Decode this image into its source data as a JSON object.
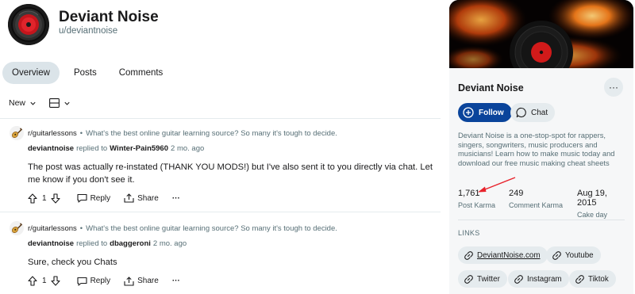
{
  "profile": {
    "name": "Deviant Noise",
    "username": "u/deviantnoise"
  },
  "tabs": [
    {
      "label": "Overview",
      "active": true
    },
    {
      "label": "Posts",
      "active": false
    },
    {
      "label": "Comments",
      "active": false
    }
  ],
  "sort": {
    "label": "New"
  },
  "comments": [
    {
      "subreddit": "r/guitarlessons",
      "separator": "•",
      "post_title": "What's the best online guitar learning source? So many it's tough to decide.",
      "author": "deviantnoise",
      "replied_to_label": "replied to",
      "replied_to": "Winter-Pain5960",
      "age": "2 mo. ago",
      "body": "The post was actually re-instated (THANK YOU MODS!) but I've also sent it to you directly via chat. Let me know if you don't see it.",
      "score": "1",
      "reply_label": "Reply",
      "share_label": "Share",
      "more_label": "···"
    },
    {
      "subreddit": "r/guitarlessons",
      "separator": "•",
      "post_title": "What's the best online guitar learning source? So many it's tough to decide.",
      "author": "deviantnoise",
      "replied_to_label": "replied to",
      "replied_to": "dbaggeroni",
      "age": "2 mo. ago",
      "body": "Sure, check you Chats",
      "score": "1",
      "reply_label": "Reply",
      "share_label": "Share",
      "more_label": "···"
    }
  ],
  "sidebar": {
    "title": "Deviant Noise",
    "more_label": "···",
    "follow_label": "Follow",
    "chat_label": "Chat",
    "about": "Deviant Noise is a one-stop-spot for rappers, singers, songwriters, music producers and musicians! Learn how to make music today and download our free music making cheat sheets",
    "stats": [
      {
        "value": "1,761",
        "label": "Post Karma"
      },
      {
        "value": "249",
        "label": "Comment Karma"
      },
      {
        "value": "Aug 19, 2015",
        "label": "Cake day"
      }
    ],
    "links_heading": "LINKS",
    "links": [
      {
        "label": "DeviantNoise.com"
      },
      {
        "label": "Youtube"
      },
      {
        "label": "Twitter"
      },
      {
        "label": "Instagram"
      },
      {
        "label": "Tiktok"
      }
    ]
  },
  "colors": {
    "accent": "#0a449b",
    "annotation_arrow": "#e8232c",
    "tab_active_bg": "#dbe4e9"
  }
}
